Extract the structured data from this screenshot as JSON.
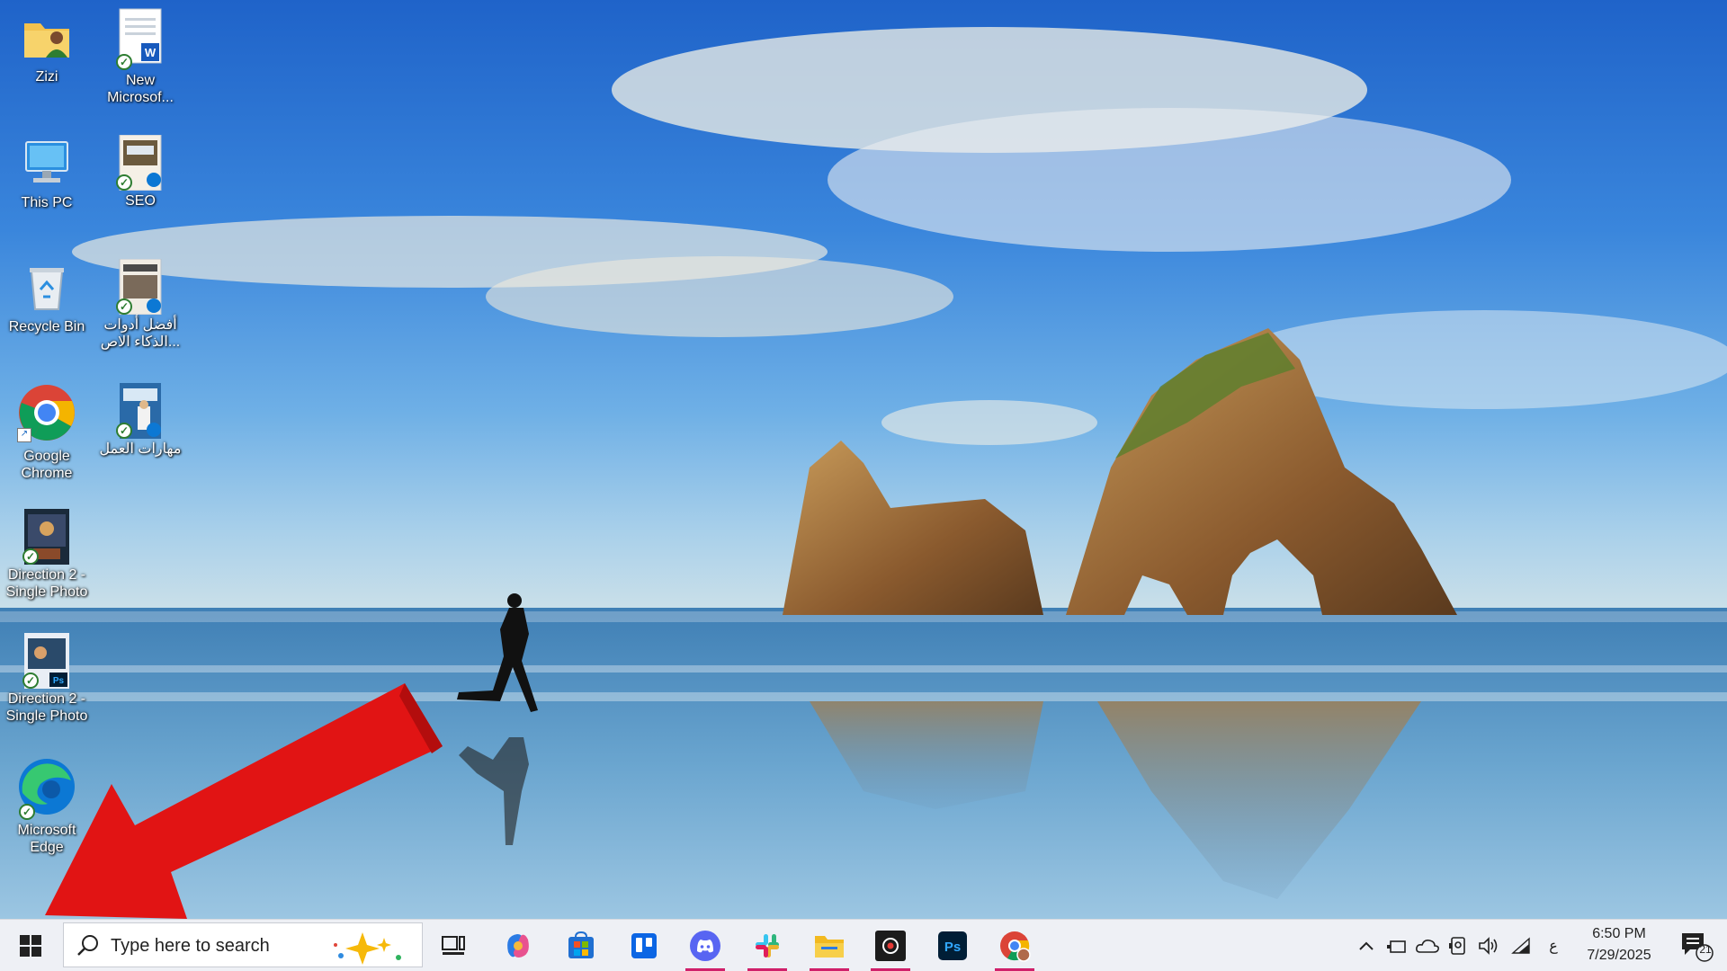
{
  "desktop": {
    "icons": [
      {
        "label": "Zizi",
        "icon": "user-folder-icon"
      },
      {
        "label": "New Microsof...",
        "icon": "word-document-icon"
      },
      {
        "label": "This PC",
        "icon": "computer-icon"
      },
      {
        "label": "SEO",
        "icon": "seo-file-icon"
      },
      {
        "label": "Recycle Bin",
        "icon": "recycle-bin-icon"
      },
      {
        "label": "أفضل أدوات الذكاء الاص...",
        "icon": "arabic-document-icon"
      },
      {
        "label": "Google Chrome",
        "icon": "chrome-icon"
      },
      {
        "label": "مهارات العمل",
        "icon": "arabic-book-icon"
      },
      {
        "label": "Direction 2 - Single Photo",
        "icon": "photo-file-icon"
      },
      {
        "label": "Direction 2 - Single Photo",
        "icon": "photoshop-file-icon"
      },
      {
        "label": "Microsoft Edge",
        "icon": "edge-icon"
      }
    ]
  },
  "taskbar": {
    "search_placeholder": "Type here to search",
    "pinned": [
      "start-icon",
      "task-view-icon",
      "copilot-icon",
      "microsoft-store-icon",
      "trello-icon",
      "discord-icon",
      "slack-icon",
      "file-explorer-icon",
      "screen-recorder-icon",
      "photoshop-icon",
      "chrome-profile-icon"
    ],
    "tray": {
      "language": "ع",
      "time": "6:50 PM",
      "date": "7/29/2025",
      "notification_count": "21"
    }
  },
  "colors": {
    "accent_underline": "#d0206a",
    "arrow": "#e11414",
    "taskbar_bg": "#eef0f5"
  }
}
